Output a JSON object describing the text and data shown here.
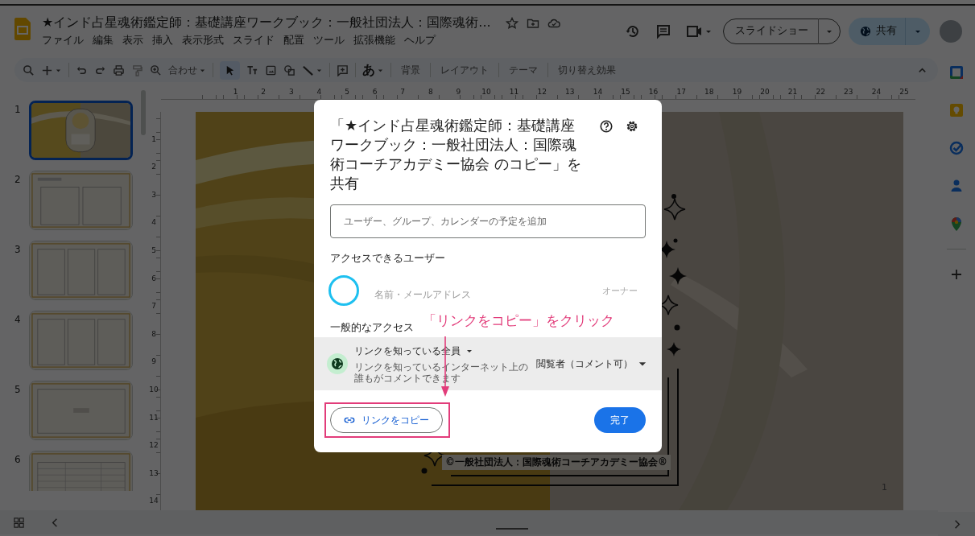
{
  "header": {
    "title": "★インド占星魂術鑑定師：基礎講座ワークブック：一般社団法人：国際魂術...",
    "menus": [
      "ファイル",
      "編集",
      "表示",
      "挿入",
      "表示形式",
      "スライド",
      "配置",
      "ツール",
      "拡張機能",
      "ヘルプ"
    ],
    "slideshow_button": "スライドショー",
    "share_button": "共有"
  },
  "toolbar": {
    "zoom": "合わせ",
    "text_style": "あ",
    "items": [
      "背景",
      "レイアウト",
      "テーマ",
      "切り替え効果"
    ]
  },
  "filmstrip": {
    "slides": [
      {
        "number": "1",
        "kind": "cover",
        "selected": true
      },
      {
        "number": "2",
        "kind": "two-column",
        "selected": false
      },
      {
        "number": "3",
        "kind": "three-column",
        "selected": false
      },
      {
        "number": "4",
        "kind": "three-column",
        "selected": false
      },
      {
        "number": "5",
        "kind": "single",
        "selected": false
      },
      {
        "number": "6",
        "kind": "table",
        "selected": false
      }
    ]
  },
  "rulers": {
    "horizontal": [
      "1",
      "2",
      "3",
      "4",
      "5",
      "6",
      "7",
      "8",
      "9",
      "10",
      "11",
      "12",
      "13",
      "14",
      "15",
      "16",
      "17",
      "18",
      "19",
      "20",
      "21",
      "22",
      "23",
      "24",
      "25"
    ],
    "vertical": [
      "1",
      "2",
      "3",
      "4",
      "5",
      "6",
      "7",
      "8",
      "9",
      "10",
      "11",
      "12",
      "13",
      "14"
    ]
  },
  "slide": {
    "footer": "©一般社団法人：国際魂術コーチアカデミー協会®",
    "page_number": "1"
  },
  "dialog": {
    "title": "「★インド占星魂術鑑定師：基礎講座ワークブック：一般社団法人：国際魂術コーチアカデミー協会 のコピー」を共有",
    "placeholder": "ユーザー、グループ、カレンダーの予定を追加",
    "people_heading": "アクセスできるユーザー",
    "owner": {
      "name": "名前・メールアドレス",
      "role": "オーナー"
    },
    "general_heading": "一般的なアクセス",
    "link_scope": "リンクを知っている全員",
    "link_description": "リンクを知っているインターネット上の誰もがコメントできます",
    "link_role": "閲覧者（コメント可）",
    "copy_link": "リンクをコピー",
    "done": "完了"
  },
  "annotation": {
    "text": "「リンクをコピー」をクリック"
  }
}
